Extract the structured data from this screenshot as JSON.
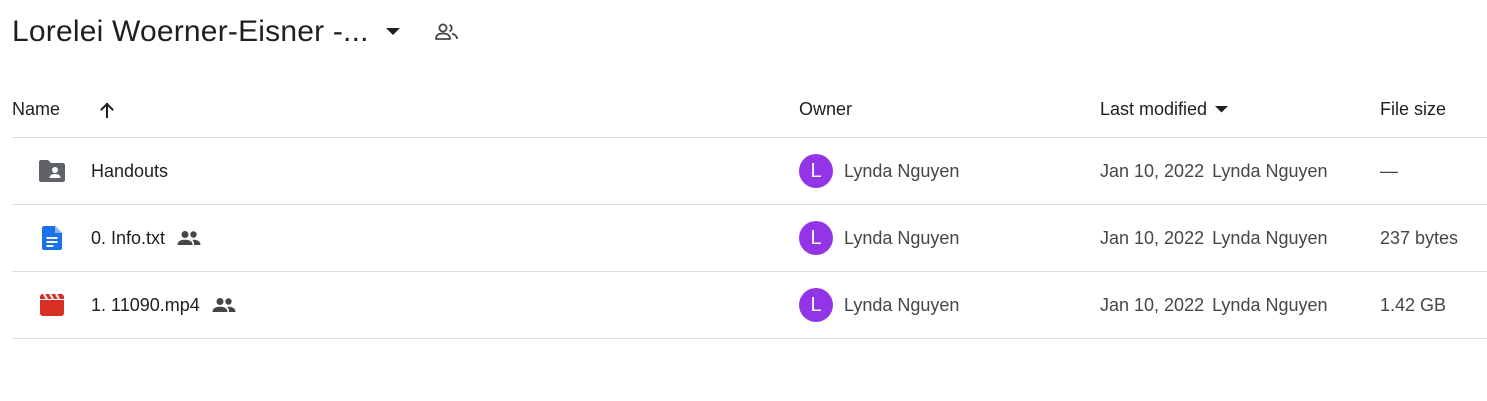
{
  "header": {
    "title": "Lorelei Woerner-Eisner -...",
    "caret_icon": "arrow-drop-down-icon",
    "shared_icon": "people-outline-icon"
  },
  "columns": {
    "name": "Name",
    "owner": "Owner",
    "last_modified": "Last modified",
    "file_size": "File size"
  },
  "colors": {
    "avatar": "#9334e6",
    "doc_blue": "#1a73e8",
    "video_red": "#d93025",
    "folder_gray": "#5f6368"
  },
  "rows": [
    {
      "icon": "shared-folder-icon",
      "name": "Handouts",
      "shared": false,
      "owner_initial": "L",
      "owner": "Lynda Nguyen",
      "date": "Jan 10, 2022",
      "modified_by": "Lynda Nguyen",
      "size": "—"
    },
    {
      "icon": "google-doc-icon",
      "name": "0. Info.txt",
      "shared": true,
      "owner_initial": "L",
      "owner": "Lynda Nguyen",
      "date": "Jan 10, 2022",
      "modified_by": "Lynda Nguyen",
      "size": "237 bytes"
    },
    {
      "icon": "video-file-icon",
      "name": "1. 11090.mp4",
      "shared": true,
      "owner_initial": "L",
      "owner": "Lynda Nguyen",
      "date": "Jan 10, 2022",
      "modified_by": "Lynda Nguyen",
      "size": "1.42 GB"
    }
  ]
}
